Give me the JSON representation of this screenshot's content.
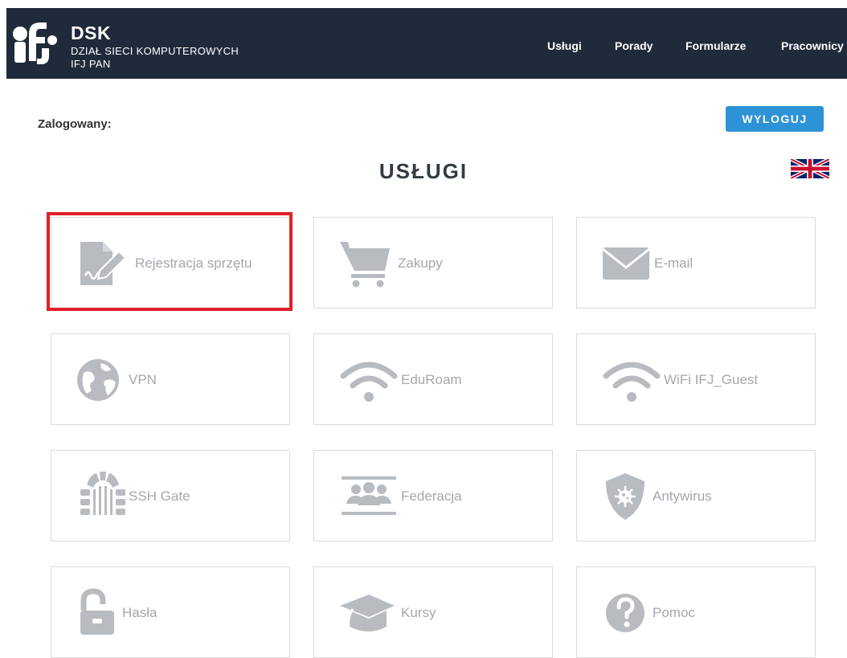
{
  "header": {
    "brand_title": "DSK",
    "brand_line1": "DZIAŁ SIECI KOMPUTEROWYCH",
    "brand_line2": "IFJ PAN",
    "nav": [
      "Usługi",
      "Porady",
      "Formularze",
      "Pracownicy"
    ]
  },
  "session": {
    "logged_in_label": "Zalogowany:",
    "logout_label": "WYLOGUJ"
  },
  "page_title": "USŁUGI",
  "services": [
    {
      "label": "Rejestracja sprzętu",
      "icon": "document-signature-icon"
    },
    {
      "label": "Zakupy",
      "icon": "shopping-cart-icon"
    },
    {
      "label": "E-mail",
      "icon": "envelope-icon"
    },
    {
      "label": "VPN",
      "icon": "globe-icon"
    },
    {
      "label": "EduRoam",
      "icon": "wifi-icon"
    },
    {
      "label": "WiFi IFJ_Guest",
      "icon": "wifi-icon"
    },
    {
      "label": "SSH Gate",
      "icon": "gate-icon"
    },
    {
      "label": "Federacja",
      "icon": "users-icon"
    },
    {
      "label": "Antywirus",
      "icon": "shield-virus-icon"
    },
    {
      "label": "Hasła",
      "icon": "unlock-icon"
    },
    {
      "label": "Kursy",
      "icon": "graduation-cap-icon"
    },
    {
      "label": "Pomoc",
      "icon": "question-icon"
    }
  ],
  "colors": {
    "header_bg": "#1f2a3a",
    "logout_bg": "#2e93d6",
    "icon_gray": "#b8bcc1",
    "highlight": "#e02027"
  }
}
